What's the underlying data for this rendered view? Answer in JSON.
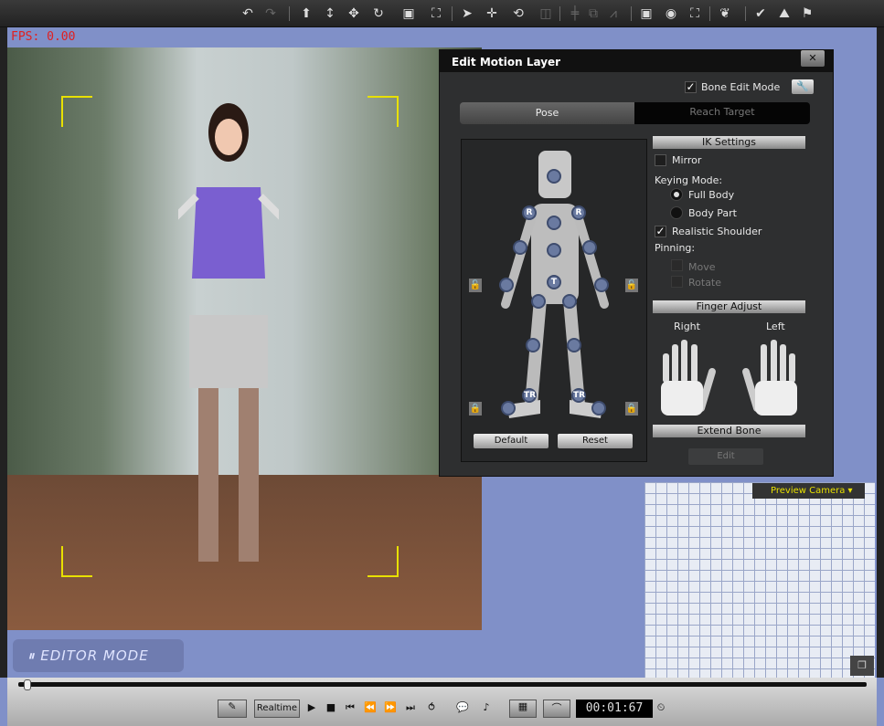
{
  "toolbar": {
    "icons": [
      "undo-icon",
      "redo-icon",
      "move-up-icon",
      "move-vertical-icon",
      "move-all-icon",
      "rotate-icon",
      "box-icon",
      "frame-icon",
      "select-icon",
      "transform-icon",
      "rotate-view-icon",
      "scale-icon",
      "align-icon",
      "copy-icon",
      "path-icon",
      "window-icon",
      "view-icon",
      "fit-icon",
      "feather-icon",
      "check-icon",
      "terrain-icon",
      "flag-icon"
    ]
  },
  "viewport": {
    "fps": "FPS: 0.00",
    "editor_mode": "EDITOR MODE",
    "preview_camera": "Preview Camera"
  },
  "dialog": {
    "title": "Edit Motion Layer",
    "close": "✕",
    "bone_edit_mode": {
      "label": "Bone Edit Mode",
      "checked": true
    },
    "tabs": [
      {
        "label": "Pose",
        "active": true
      },
      {
        "label": "Reach Target",
        "active": false
      }
    ],
    "ik_settings": "IK Settings",
    "mirror": {
      "label": "Mirror",
      "checked": false
    },
    "keying_mode": "Keying Mode:",
    "keying_options": [
      {
        "label": "Full Body",
        "selected": true
      },
      {
        "label": "Body Part",
        "selected": false
      }
    ],
    "realistic_shoulder": {
      "label": "Realistic Shoulder",
      "checked": true
    },
    "pinning": "Pinning:",
    "pin_move": "Move",
    "pin_rotate": "Rotate",
    "finger_adjust": "Finger Adjust",
    "right": "Right",
    "left": "Left",
    "extend_bone": "Extend Bone",
    "edit": "Edit",
    "default": "Default",
    "reset": "Reset",
    "joint_labels": {
      "r": "R",
      "t": "T",
      "tr": "TR"
    }
  },
  "playback": {
    "realtime": "Realtime",
    "time": "00:01:67"
  }
}
